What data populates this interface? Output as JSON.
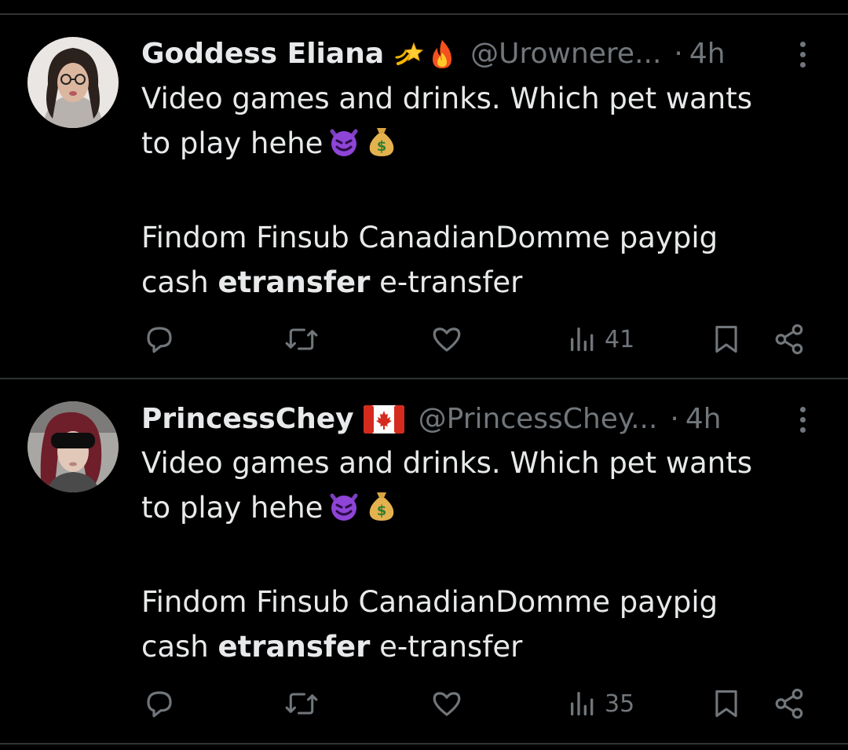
{
  "tweets": [
    {
      "display_name": "Goddess Eliana",
      "name_emojis": [
        "dizzy-emoji",
        "fire-emoji"
      ],
      "handle": "@Urownere...",
      "separator": "·",
      "time": "4h",
      "line1": "Video games and drinks. Which pet wants",
      "line2": "to play hehe",
      "line3": "Findom Finsub CanadianDomme paypig",
      "line4_pre": "cash ",
      "line4_bold": "etransfer",
      "line4_post": " e-transfer",
      "views": "41"
    },
    {
      "display_name": "PrincessChey",
      "name_emojis": [
        "canada-flag-emoji"
      ],
      "handle": "@PrincessChey...",
      "separator": "·",
      "time": "4h",
      "line1": "Video games and drinks. Which pet wants",
      "line2": "to play hehe",
      "line3": "Findom Finsub CanadianDomme paypig",
      "line4_pre": "cash ",
      "line4_bold": "etransfer",
      "line4_post": " e-transfer",
      "views": "35"
    }
  ],
  "icons": {
    "reply": "reply-icon",
    "repost": "repost-icon",
    "like": "like-icon",
    "views": "views-icon",
    "bookmark": "bookmark-icon",
    "share": "share-icon",
    "more": "more-options-icon"
  },
  "colors": {
    "background": "#000000",
    "text": "#e7e9ea",
    "secondary": "#71767b",
    "divider": "#2f3336"
  }
}
